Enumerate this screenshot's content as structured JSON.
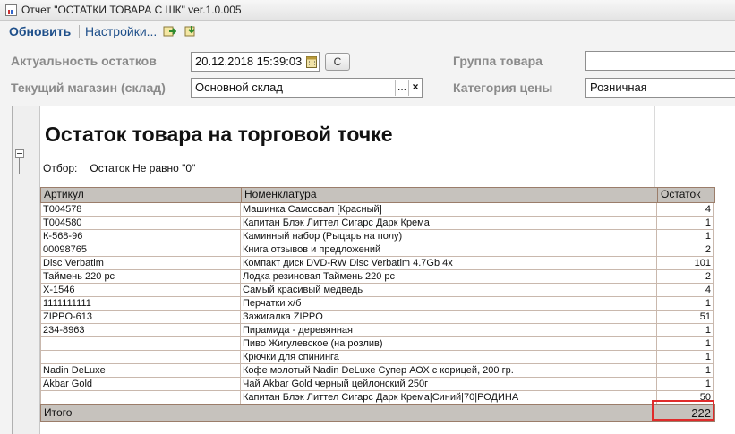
{
  "window": {
    "title": "Отчет  \"ОСТАТКИ ТОВАРА С ШК\" ver.1.0.005"
  },
  "toolbar": {
    "refresh_label": "Обновить",
    "settings_label": "Настройки..."
  },
  "filters": {
    "stock_date_label": "Актуальность остатков",
    "stock_date_value": "20.12.2018 15:39:03",
    "c_button_label": "С",
    "store_label": "Текущий магазин (склад)",
    "store_value": "Основной склад",
    "product_group_label": "Группа товара",
    "product_group_value": "",
    "price_category_label": "Категория цены",
    "price_category_value": "Розничная",
    "ellipsis": "...",
    "clear": "×"
  },
  "report": {
    "title": "Остаток товара на торговой точке",
    "filter_label": "Отбор:",
    "filter_value": "Остаток Не равно \"0\"",
    "columns": [
      "Артикул",
      "Номенклатура",
      "Остаток"
    ],
    "rows": [
      {
        "sku": "T004578",
        "name": "Машинка Самосвал [Красный]",
        "qty": "4"
      },
      {
        "sku": "T004580",
        "name": "Капитан Блэк Литтел Сигарс Дарк Крема",
        "qty": "1"
      },
      {
        "sku": "К-568-96",
        "name": "Каминный набор (Рыцарь на полу)",
        "qty": "1"
      },
      {
        "sku": "00098765",
        "name": "Книга отзывов и предложений",
        "qty": "2"
      },
      {
        "sku": "Disc Verbatim",
        "name": "Компакт диск DVD-RW Disc Verbatim 4.7Gb 4x",
        "qty": "101"
      },
      {
        "sku": "Таймень 220 pc",
        "name": "Лодка резиновая Таймень 220 рс",
        "qty": "2"
      },
      {
        "sku": "Х-1546",
        "name": "Самый красивый медведь",
        "qty": "4"
      },
      {
        "sku": "1111111111",
        "name": "Перчатки х/б",
        "qty": "1"
      },
      {
        "sku": "ZIPPO-613",
        "name": "Зажигалка ZIPPO",
        "qty": "51"
      },
      {
        "sku": "234-8963",
        "name": "Пирамида - деревянная",
        "qty": "1"
      },
      {
        "sku": "",
        "name": "Пиво Жигулевское (на розлив)",
        "qty": "1"
      },
      {
        "sku": "",
        "name": "Крючки для спининга",
        "qty": "1"
      },
      {
        "sku": "Nadin DeLuxe",
        "name": "Кофе молотый Nadin DeLuxe Супер АОХ с корицей, 200 гр.",
        "qty": "1"
      },
      {
        "sku": "Akbar Gold",
        "name": "Чай Akbar Gold черный цейлонский 250г",
        "qty": "1"
      },
      {
        "sku": "",
        "name": "Капитан Блэк Литтел Сигарс Дарк Крема|Синий|70|РОДИНА",
        "qty": "50"
      }
    ],
    "total_label": "Итого",
    "total_value": "222"
  },
  "colors": {
    "header_bg": "#c6c2bd",
    "header_border": "#9b7d6a",
    "highlight": "#e02b2b",
    "toolbar_link": "#1e4f8a"
  }
}
